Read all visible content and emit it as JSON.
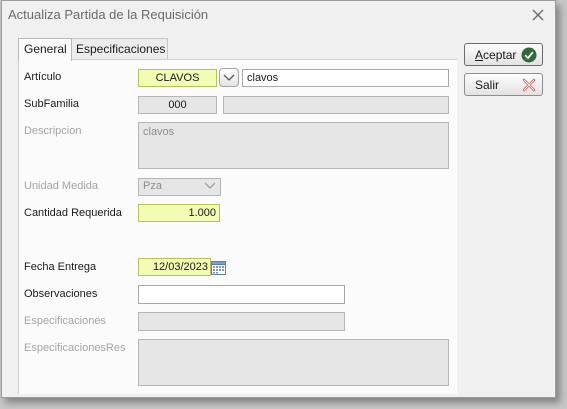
{
  "window": {
    "title": "Actualiza Partida de la Requisición"
  },
  "tabs": [
    {
      "label": "General"
    },
    {
      "label": "Especificaciones"
    }
  ],
  "form": {
    "articulo": {
      "label": "Artículo",
      "code": "CLAVOS",
      "description": "clavos"
    },
    "subfamilia": {
      "label": "SubFamilia",
      "code": "000",
      "description": ""
    },
    "descripcion": {
      "label": "Descripcion",
      "value": "clavos"
    },
    "unidad_medida": {
      "label": "Unidad Medida",
      "value": "Pza"
    },
    "cantidad_requerida": {
      "label": "Cantidad Requerida",
      "value": "1.000"
    },
    "fecha_entrega": {
      "label": "Fecha Entrega",
      "value": "12/03/2023"
    },
    "observaciones": {
      "label": "Observaciones",
      "value": ""
    },
    "especificaciones": {
      "label": "Especificaciones",
      "value": ""
    },
    "especificaciones_res": {
      "label": "EspecificacionesRes",
      "value": ""
    }
  },
  "buttons": {
    "aceptar": {
      "first": "A",
      "rest": "ceptar"
    },
    "salir": {
      "label": "Salir"
    }
  },
  "icons": {
    "close": "close-icon",
    "aceptar": "checkmark-icon",
    "salir": "cancel-x-icon",
    "dropdown": "chevron-down-icon",
    "calendar": "calendar-icon"
  },
  "colors": {
    "required_field_bg": "#f2fcb3",
    "disabled_field_bg": "#e6e6e6",
    "aceptar_icon": "#2f6b3a",
    "salir_icon": "#d9534f"
  }
}
